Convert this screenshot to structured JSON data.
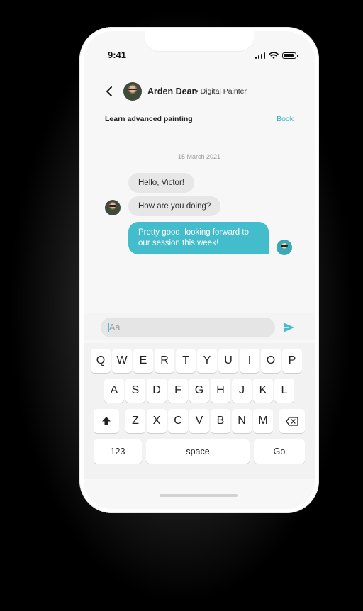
{
  "status_bar": {
    "time": "9:41"
  },
  "header": {
    "name": "Arden Dean",
    "role": "• Digital Painter",
    "session_title": "Learn advanced painting",
    "book_label": "Book"
  },
  "chat": {
    "date": "15 March 2021",
    "incoming": [
      "Hello, Victor!",
      "How are you doing?"
    ],
    "outgoing": [
      "Pretty good, looking forward to our session this week!"
    ]
  },
  "composer": {
    "placeholder": "Aa"
  },
  "keyboard": {
    "row1": [
      "Q",
      "W",
      "E",
      "R",
      "T",
      "Y",
      "U",
      "I",
      "O",
      "P"
    ],
    "row2": [
      "A",
      "S",
      "D",
      "F",
      "G",
      "H",
      "J",
      "K",
      "L"
    ],
    "row3": [
      "Z",
      "X",
      "C",
      "V",
      "B",
      "N",
      "M"
    ],
    "numbers_label": "123",
    "space_label": "space",
    "go_label": "Go",
    "shift_icon": "shift-icon",
    "delete_icon": "backspace-icon"
  },
  "colors": {
    "accent": "#43bccb",
    "incoming_bubble": "#e7e7e7",
    "background": "#f7f7f7"
  }
}
